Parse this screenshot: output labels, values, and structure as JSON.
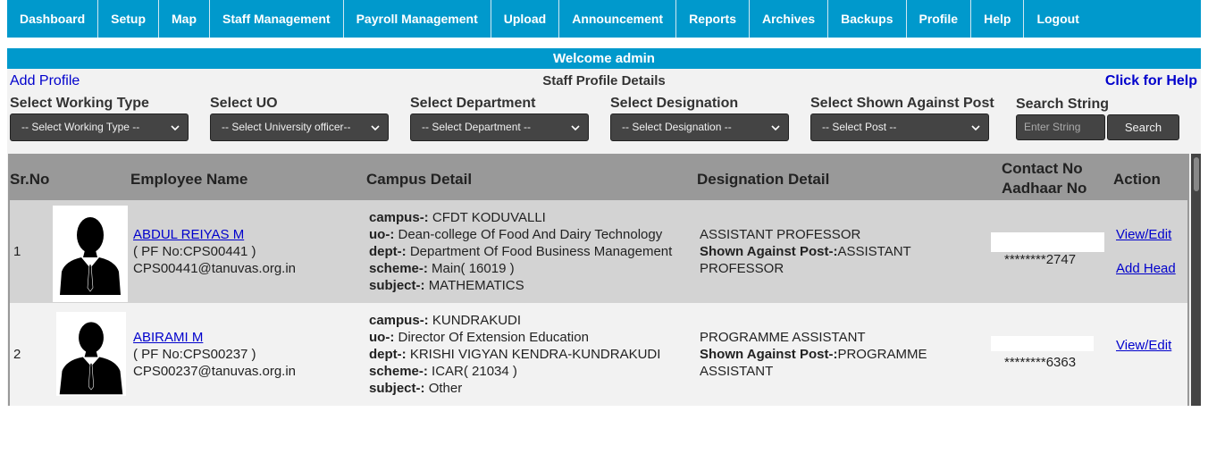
{
  "nav": [
    "Dashboard",
    "Setup",
    "Map",
    "Staff Management",
    "Payroll Management",
    "Upload",
    "Announcement",
    "Reports",
    "Archives",
    "Backups",
    "Profile",
    "Help",
    "Logout"
  ],
  "welcome": "Welcome admin",
  "toolbar": {
    "add_profile": "Add Profile",
    "title": "Staff Profile Details",
    "help": "Click for Help"
  },
  "filters": [
    {
      "label": "Select Working Type",
      "value": "-- Select Working Type --"
    },
    {
      "label": "Select UO",
      "value": "-- Select University officer--"
    },
    {
      "label": "Select Department",
      "value": "-- Select Department --"
    },
    {
      "label": "Select Designation",
      "value": "-- Select Designation --"
    },
    {
      "label": "Select Shown Against Post",
      "value": "-- Select Post --"
    }
  ],
  "search": {
    "label": "Search String",
    "placeholder": "Enter String",
    "button": "Search"
  },
  "table": {
    "headers": {
      "srno": "Sr.No",
      "name": "Employee Name",
      "campus": "Campus Detail",
      "designation": "Designation Detail",
      "contact1": "Contact No",
      "contact2": "Aadhaar No",
      "action": "Action"
    },
    "keys": {
      "campus": "campus-:",
      "uo": "uo-:",
      "dept": "dept-:",
      "scheme": "scheme-:",
      "subject": "subject-:",
      "shown": "Shown Against Post-:"
    },
    "rows": [
      {
        "sr": "1",
        "name": "ABDUL REIYAS M",
        "pf": "( PF No:CPS00441 )",
        "email": "CPS00441@tanuvas.org.in",
        "campus": "CFDT KODUVALLI",
        "uo": "Dean-college Of Food And Dairy Technology",
        "dept": "Department Of Food Business Management",
        "scheme": "Main( 16019 )",
        "subject": "MATHEMATICS",
        "designation": "ASSISTANT PROFESSOR",
        "shown_post_1": "ASSISTANT",
        "shown_post_2": "PROFESSOR",
        "aadhaar": "********2747",
        "actions": [
          "View/Edit",
          "Add Head"
        ]
      },
      {
        "sr": "2",
        "name": "ABIRAMI M",
        "pf": "( PF No:CPS00237 )",
        "email": "CPS00237@tanuvas.org.in",
        "campus": "KUNDRAKUDI",
        "uo": "Director Of Extension Education",
        "dept": "KRISHI VIGYAN KENDRA-KUNDRAKUDI",
        "scheme": "ICAR( 21034 )",
        "subject": "Other",
        "designation": "PROGRAMME ASSISTANT",
        "shown_post_1": "PROGRAMME",
        "shown_post_2": "ASSISTANT",
        "aadhaar": "********6363",
        "actions": [
          "View/Edit"
        ]
      }
    ]
  }
}
